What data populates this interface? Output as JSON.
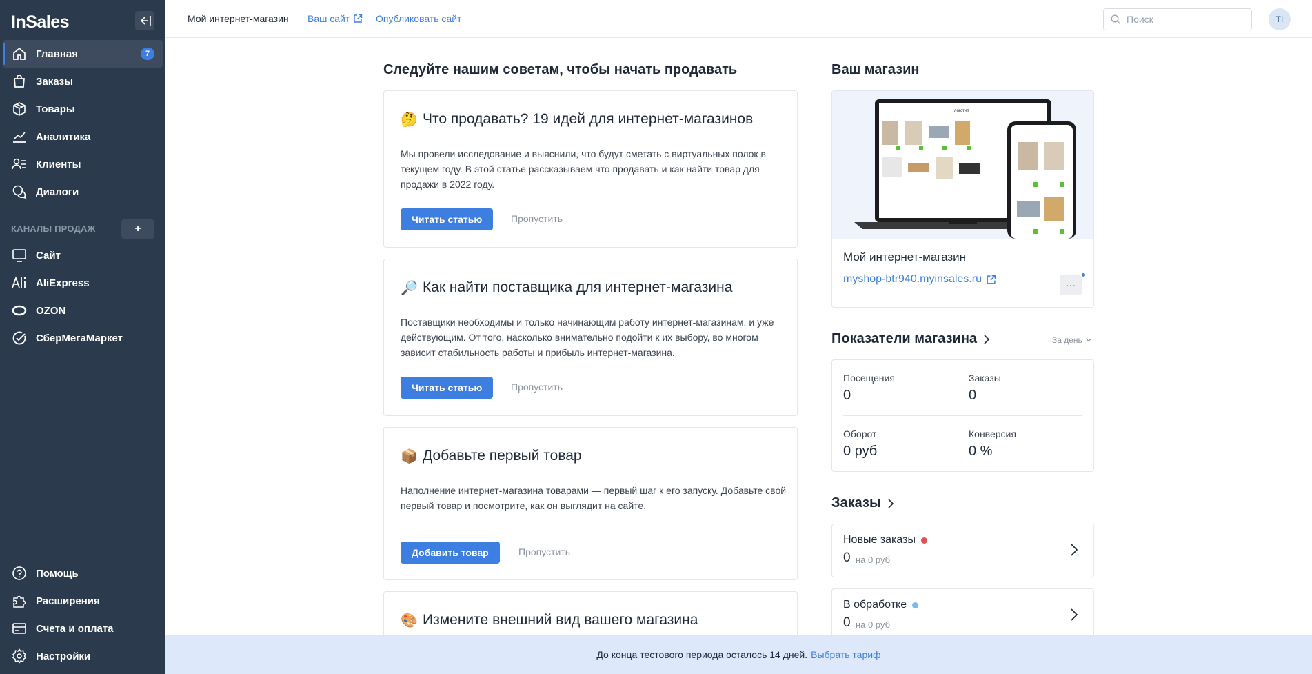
{
  "app": {
    "logo": "InSales"
  },
  "sidebar": {
    "items": [
      {
        "label": "Главная",
        "badge": "7",
        "icon": "home-icon"
      },
      {
        "label": "Заказы",
        "icon": "bag-icon"
      },
      {
        "label": "Товары",
        "icon": "box-icon"
      },
      {
        "label": "Аналитика",
        "icon": "chart-icon"
      },
      {
        "label": "Клиенты",
        "icon": "clients-icon"
      },
      {
        "label": "Диалоги",
        "icon": "chat-icon"
      }
    ],
    "channels_title": "КАНАЛЫ ПРОДАЖ",
    "channels_add": "+",
    "channels": [
      {
        "label": "Сайт",
        "icon": "monitor-icon"
      },
      {
        "label": "AliExpress",
        "icon": "aliexpress-icon"
      },
      {
        "label": "OZON",
        "icon": "ozon-icon"
      },
      {
        "label": "СберМегаМаркет",
        "icon": "sbermegamarket-icon"
      }
    ],
    "bottom": [
      {
        "label": "Помощь",
        "icon": "help-icon"
      },
      {
        "label": "Расширения",
        "icon": "puzzle-icon"
      },
      {
        "label": "Счета и оплата",
        "icon": "billing-icon"
      },
      {
        "label": "Настройки",
        "icon": "gear-icon"
      }
    ]
  },
  "topbar": {
    "shop_title": "Мой интернет-магазин",
    "your_site": "Ваш сайт",
    "publish": "Опубликовать сайт",
    "search_placeholder": "Поиск",
    "avatar": "TI"
  },
  "tips": {
    "heading": "Следуйте нашим советам, чтобы начать продавать",
    "cards": [
      {
        "emoji": "🤔",
        "title": "Что продавать? 19 идей для интернет-магазинов",
        "text": "Мы провели исследование и выяснили, что будут сметать с виртуальных полок в текущем году. В этой статье рассказываем что продавать и как найти товар для продажи в 2022 году.",
        "button": "Читать статью",
        "skip": "Пропустить"
      },
      {
        "emoji": "🔎",
        "title": "Как найти поставщика для интернет-магазина",
        "text": "Поставщики необходимы и только начинающим работу интернет-магазинам, и уже действующим. От того, насколько внимательно подойти к их выбору, во многом зависит стабильность работы и прибыль интернет-магазина.",
        "button": "Читать статью",
        "skip": "Пропустить"
      },
      {
        "emoji": "📦",
        "title": "Добавьте первый товар",
        "text": "Наполнение интернет-магазина товарами — первый шаг к его запуску. Добавьте свой первый товар и посмотрите, как он выглядит на сайте.",
        "button": "Добавить товар",
        "skip": "Пропустить"
      },
      {
        "emoji": "🎨",
        "title": "Измените внешний вид вашего магазина"
      }
    ]
  },
  "shop": {
    "heading": "Ваш магазин",
    "name": "Мой интернет-магазин",
    "url": "myshop-btr940.myinsales.ru",
    "more": "···",
    "preview_logo": "логотип"
  },
  "metrics": {
    "heading": "Показатели магазина",
    "period": "За день",
    "visits_label": "Посещения",
    "visits_value": "0",
    "orders_label": "Заказы",
    "orders_value": "0",
    "turnover_label": "Оборот",
    "turnover_value": "0 руб",
    "conversion_label": "Конверсия",
    "conversion_value": "0 %"
  },
  "orders": {
    "heading": "Заказы",
    "rows": [
      {
        "title": "Новые заказы",
        "count": "0",
        "sum": "на 0 руб",
        "dot_color": "#e05252"
      },
      {
        "title": "В обработке",
        "count": "0",
        "sum": "на 0 руб",
        "dot_color": "#7ab8e8"
      }
    ]
  },
  "trial": {
    "text": "До конца тестового периода осталось 14 дней.",
    "link": "Выбрать тариф"
  },
  "colors": {
    "sidebar_bg": "#2c3a4d",
    "accent": "#3d7fe0",
    "banner_bg": "#dde9fa"
  }
}
